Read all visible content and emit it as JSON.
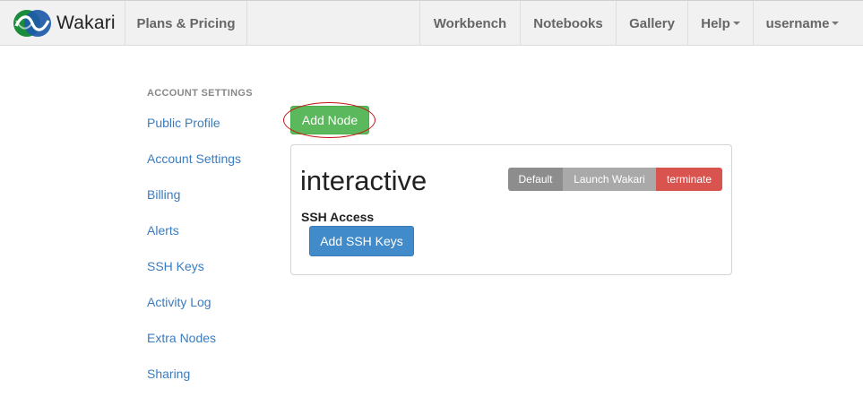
{
  "navbar": {
    "brand": "Wakari",
    "plans": "Plans & Pricing",
    "workbench": "Workbench",
    "notebooks": "Notebooks",
    "gallery": "Gallery",
    "help": "Help",
    "user": "username"
  },
  "sidebar": {
    "header": "ACCOUNT SETTINGS",
    "items": [
      "Public Profile",
      "Account Settings",
      "Billing",
      "Alerts",
      "SSH Keys",
      "Activity Log",
      "Extra Nodes",
      "Sharing"
    ]
  },
  "main": {
    "add_node": "Add Node",
    "node": {
      "name": "interactive",
      "btn_default": "Default",
      "btn_launch": "Launch Wakari",
      "btn_terminate": "terminate",
      "ssh_label": "SSH Access",
      "add_ssh_keys": "Add SSH Keys"
    }
  },
  "colors": {
    "nav_bg": "#f1f1f1",
    "link": "#3a7cc0",
    "success": "#5cb85c",
    "primary": "#428bca",
    "danger": "#d9534f",
    "highlight": "#c81414"
  }
}
